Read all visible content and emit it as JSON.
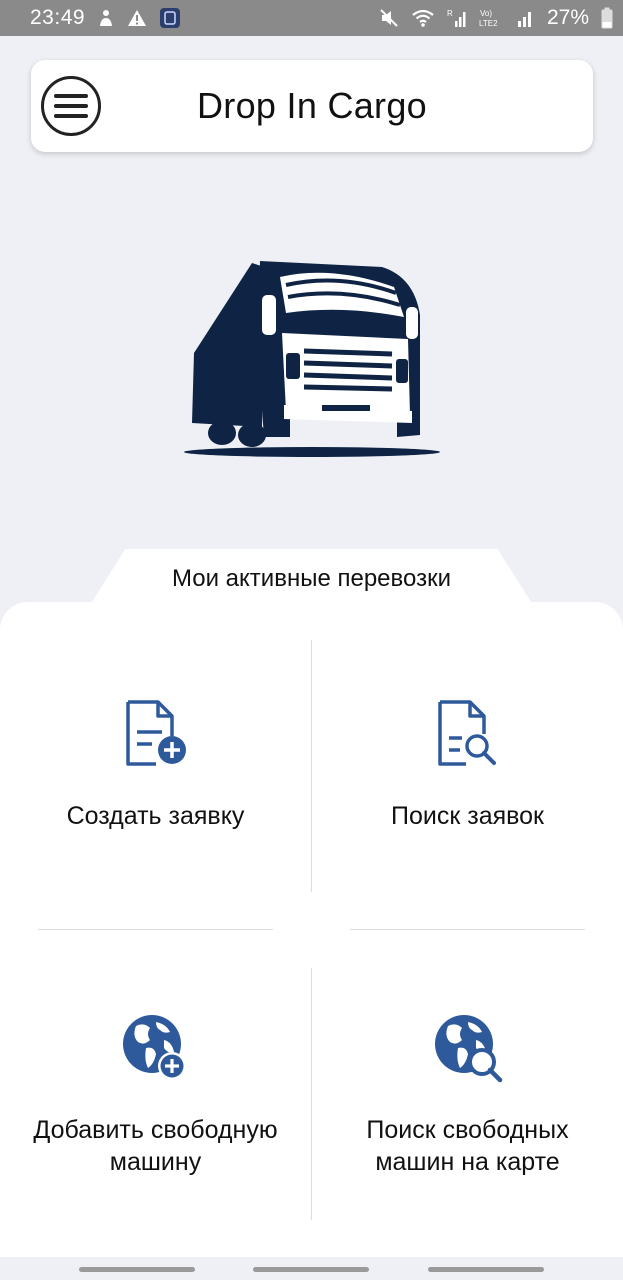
{
  "status_bar": {
    "time": "23:49",
    "battery_percent": "27%",
    "icons_left": [
      "person-alert-icon",
      "warning-icon",
      "app-badge-icon"
    ],
    "icons_right": [
      "mute-icon",
      "wifi-icon",
      "signal-r-icon",
      "volte-lte2-icon",
      "signal-icon",
      "battery-icon"
    ]
  },
  "header": {
    "title": "Drop In Cargo",
    "menu_icon": "hamburger-menu-icon"
  },
  "logo": {
    "icon": "truck-icon",
    "color": "#0f2444"
  },
  "active_tab": {
    "label": "Мои активные перевозки"
  },
  "tiles": [
    {
      "label": "Создать заявку",
      "icon": "document-add-icon"
    },
    {
      "label": "Поиск заявок",
      "icon": "document-search-icon"
    },
    {
      "label": "Добавить свободную машину",
      "icon": "globe-add-icon"
    },
    {
      "label": "Поиск свободных машин на карте",
      "icon": "globe-search-icon"
    }
  ],
  "colors": {
    "accent": "#2e5a9c",
    "background": "#eef0f5",
    "panel": "#ffffff"
  }
}
